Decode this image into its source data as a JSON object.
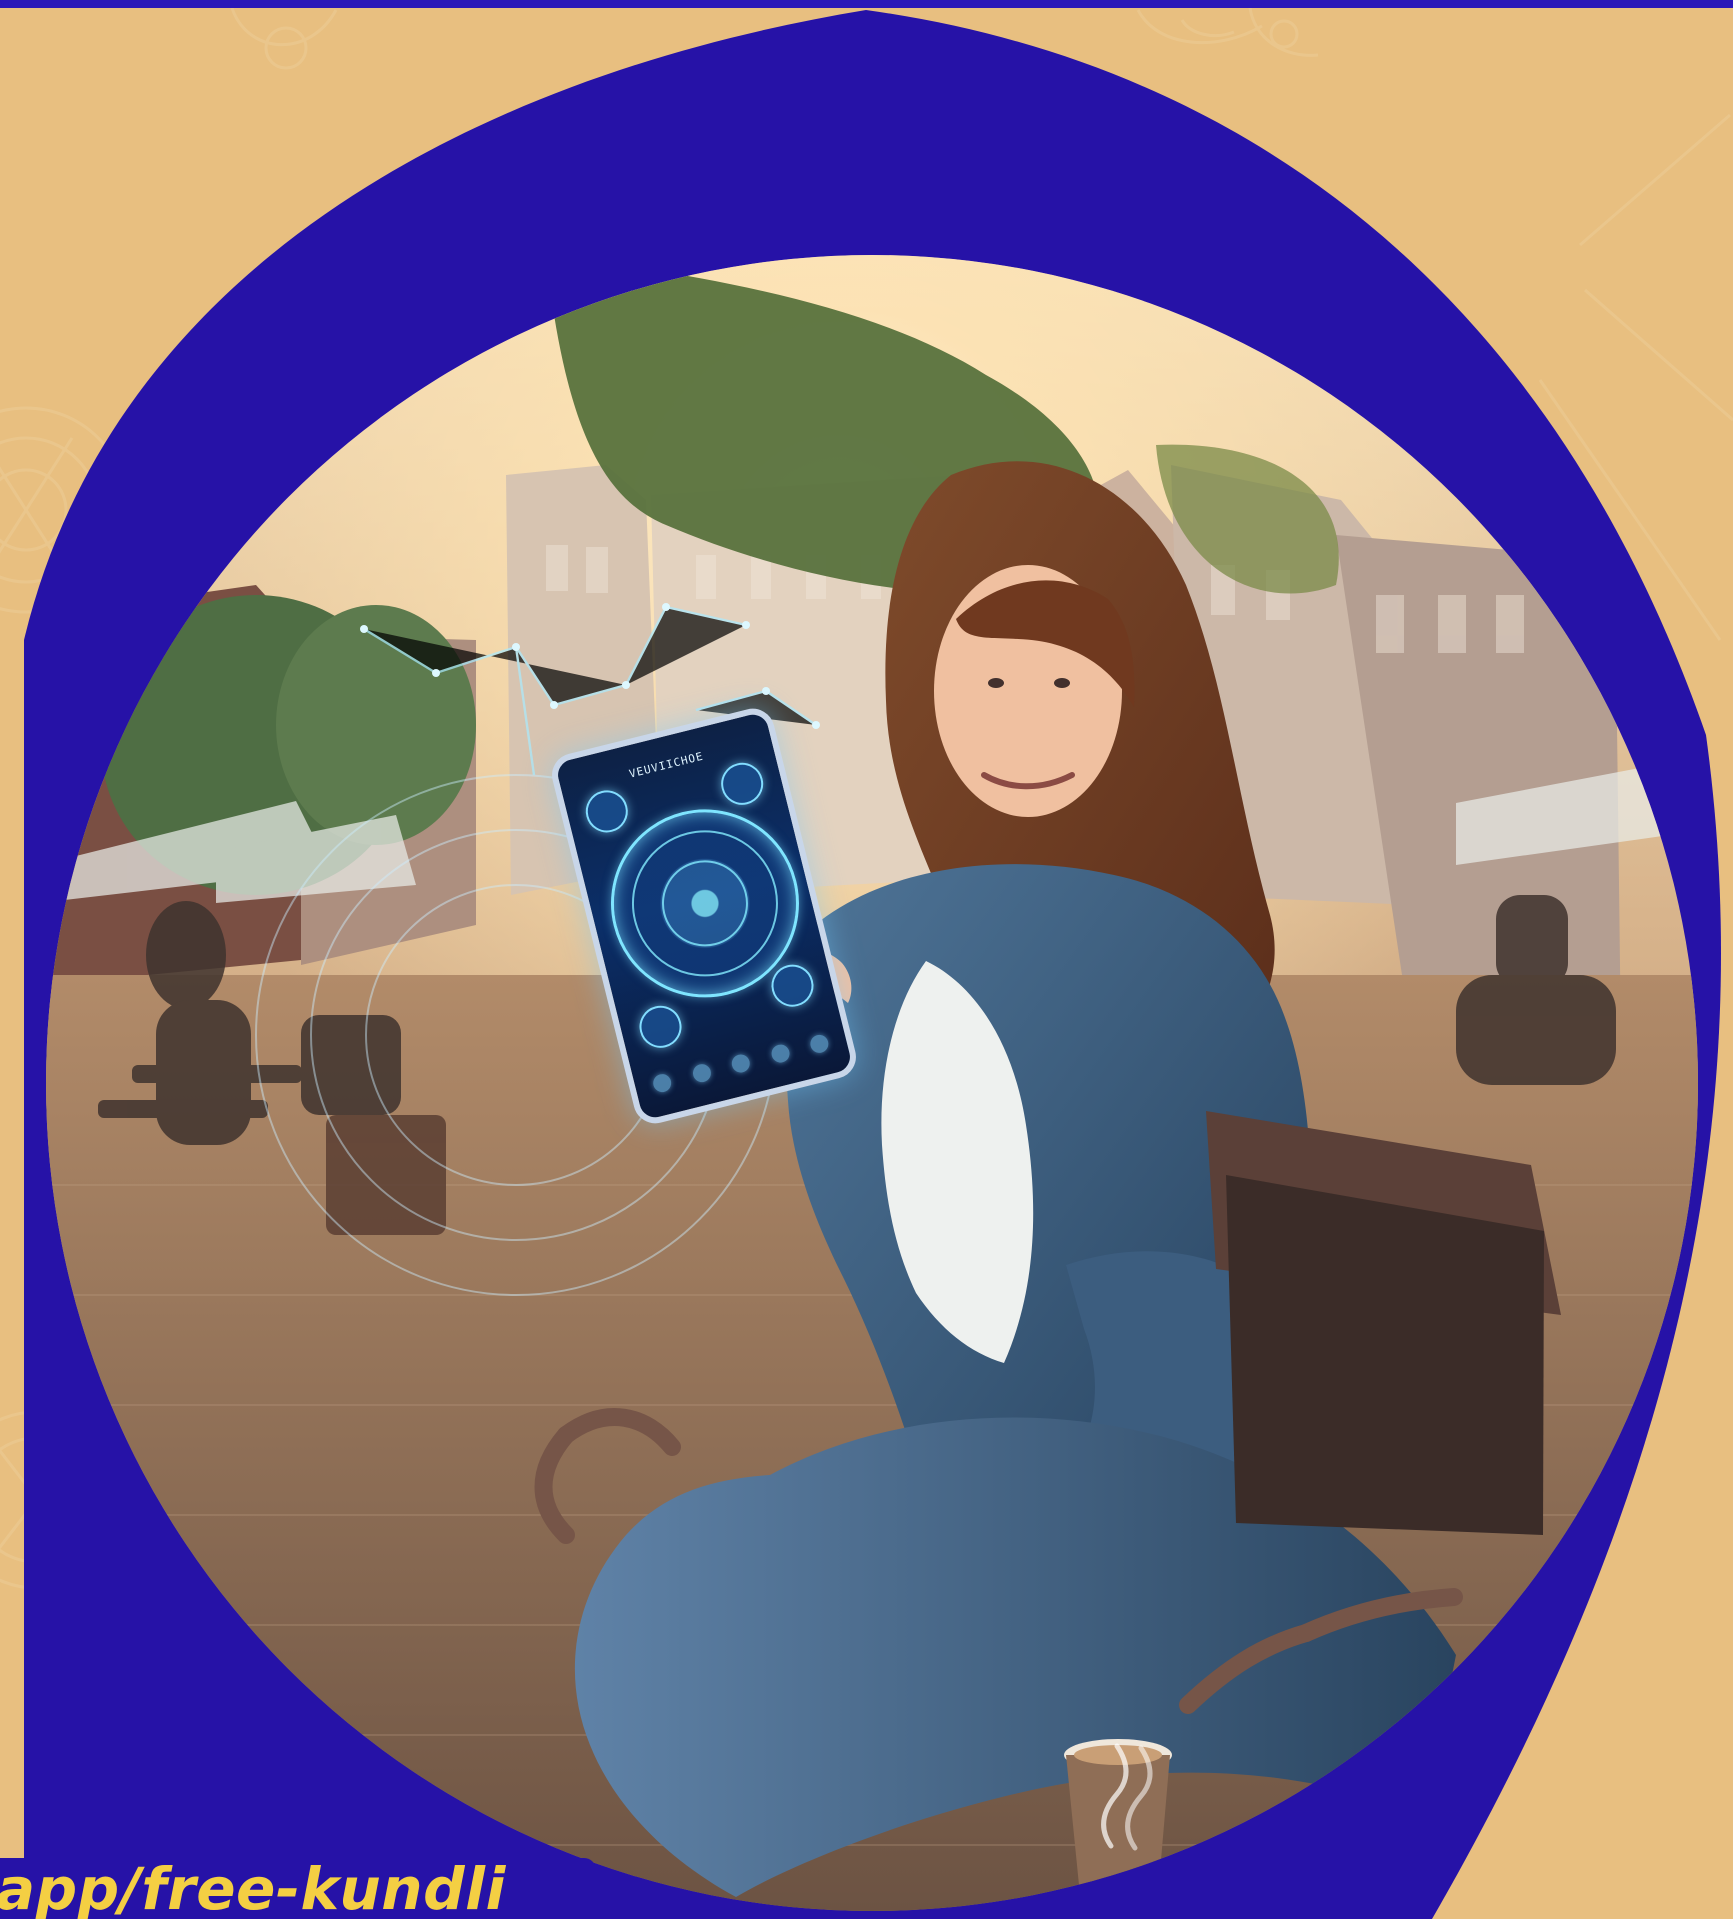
{
  "banner": {
    "url_text": "app/free-kundli"
  },
  "colors": {
    "background": "#e8bf80",
    "primary_blue": "#2612a7",
    "accent_yellow": "#f4cf43"
  },
  "icons": {
    "background": "zodiac-line-art",
    "phone": "horoscope-wheel",
    "coffee": "coffee-cup"
  }
}
